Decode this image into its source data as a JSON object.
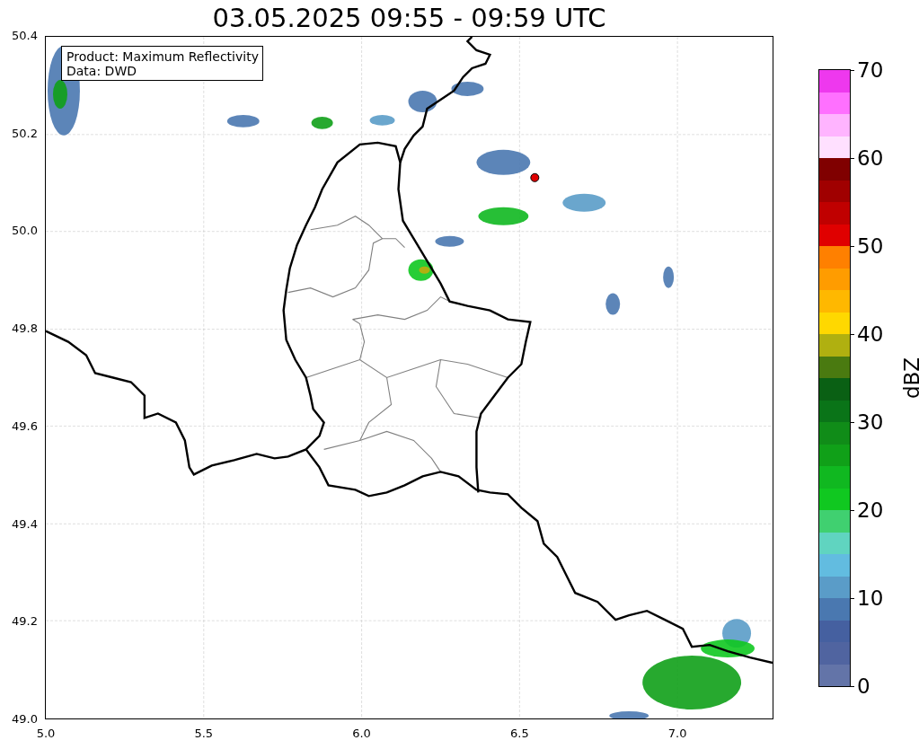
{
  "title": "03.05.2025 09:55 - 09:59 UTC",
  "info_box": [
    "Product: Maximum Reflectivity",
    "Data: DWD"
  ],
  "map": {
    "yticks": [
      "50.4",
      "50.2",
      "50.0",
      "49.8",
      "49.6",
      "49.4",
      "49.2",
      "49.0"
    ],
    "xticks": [
      "5.0",
      "5.5",
      "6.0",
      "6.5",
      "7.0"
    ]
  },
  "colorbar": {
    "label": "dBZ",
    "ticks": [
      "70",
      "60",
      "50",
      "40",
      "30",
      "20",
      "10",
      "0"
    ],
    "bands": [
      {
        "color": "#6374a8"
      },
      {
        "color": "#5064a0"
      },
      {
        "color": "#4560a0"
      },
      {
        "color": "#4a78b0"
      },
      {
        "color": "#5a9cc8"
      },
      {
        "color": "#62bce0"
      },
      {
        "color": "#60d4c0"
      },
      {
        "color": "#40d070"
      },
      {
        "color": "#10c820"
      },
      {
        "color": "#10b820"
      },
      {
        "color": "#10a018"
      },
      {
        "color": "#108c18"
      },
      {
        "color": "#0a7418"
      },
      {
        "color": "#0a6014"
      },
      {
        "color": "#4a7a10"
      },
      {
        "color": "#b0b010"
      },
      {
        "color": "#ffd800"
      },
      {
        "color": "#ffb800"
      },
      {
        "color": "#ff9c00"
      },
      {
        "color": "#ff8000"
      },
      {
        "color": "#e00000"
      },
      {
        "color": "#c00000"
      },
      {
        "color": "#a00000"
      },
      {
        "color": "#800000"
      },
      {
        "color": "#ffe0ff"
      },
      {
        "color": "#ffb4ff"
      },
      {
        "color": "#ff70ff"
      },
      {
        "color": "#ee38ee"
      }
    ]
  }
}
